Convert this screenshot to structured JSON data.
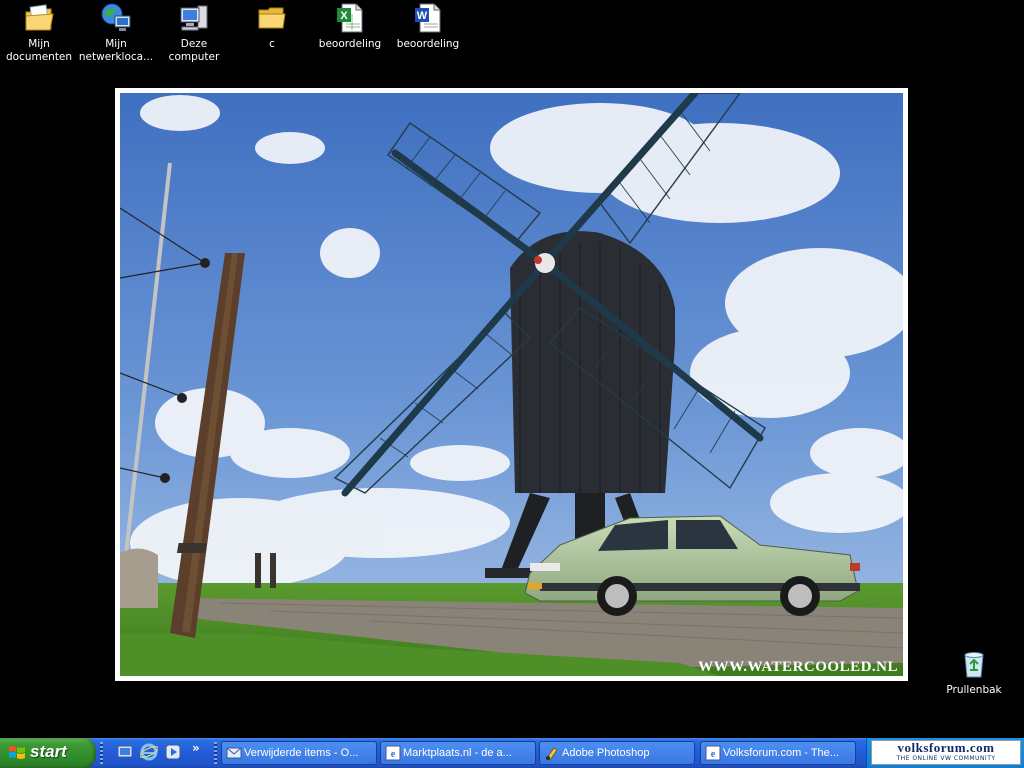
{
  "desktop": {
    "icons": [
      {
        "label": "Mijn documenten",
        "icon": "my-documents-icon"
      },
      {
        "label": "Mijn netwerkloca...",
        "icon": "network-places-icon"
      },
      {
        "label": "Deze computer",
        "icon": "my-computer-icon"
      },
      {
        "label": "c",
        "icon": "folder-icon"
      },
      {
        "label": "beoordeling",
        "icon": "excel-file-icon"
      },
      {
        "label": "beoordeling",
        "icon": "word-file-icon"
      },
      {
        "label": "Prullenbak",
        "icon": "recycle-bin-icon"
      }
    ],
    "wallpaper": {
      "subject": "windmill-and-car-photo",
      "watermark": "WWW.WATERCOOLED.NL"
    }
  },
  "taskbar": {
    "start_label": "start",
    "quick_launch": [
      "show-desktop-icon",
      "internet-explorer-icon",
      "windows-media-icon"
    ],
    "overflow": "»",
    "tasks": [
      {
        "label": "Verwijderde items - O...",
        "icon": "outlook-icon"
      },
      {
        "label": "Marktplaats.nl - de a...",
        "icon": "ie-window-icon"
      },
      {
        "label": "Adobe Photoshop",
        "icon": "photoshop-icon"
      },
      {
        "label": "Volksforum.com - The...",
        "icon": "ie-window-icon"
      }
    ],
    "tray_banner": {
      "title": "volksforum.com",
      "subtitle": "THE ONLINE VW COMMUNITY"
    }
  },
  "colors": {
    "taskbar_blue": "#245edb",
    "start_green": "#3c9b36",
    "desktop_bg": "#000000"
  }
}
